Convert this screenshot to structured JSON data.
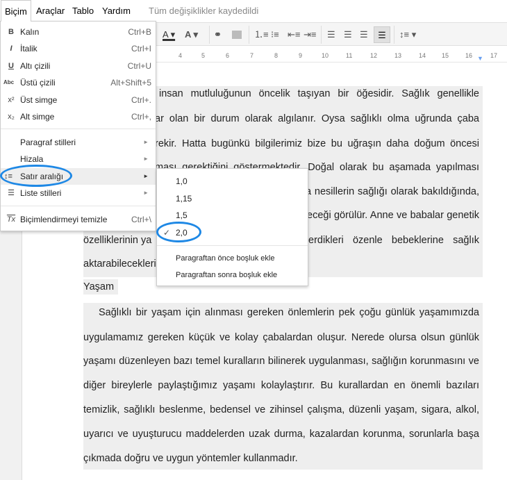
{
  "menubar": {
    "items": [
      "Biçim",
      "Araçlar",
      "Tablo",
      "Yardım"
    ],
    "status": "Tüm değişiklikler kaydedildi"
  },
  "toolbar": {
    "icons": [
      "text-color-icon",
      "highlight-color-icon",
      "link-icon",
      "image-icon",
      "numbered-list-icon",
      "bulleted-list-icon",
      "decrease-indent-icon",
      "increase-indent-icon",
      "align-left-icon",
      "align-center-icon",
      "align-right-icon",
      "justify-icon",
      "line-spacing-icon"
    ],
    "active": "justify-icon"
  },
  "ruler": {
    "ticks": [
      "4",
      "5",
      "6",
      "7",
      "8",
      "9",
      "10",
      "11",
      "12",
      "13",
      "14",
      "15",
      "16",
      "17"
    ]
  },
  "format_menu": {
    "items": [
      {
        "icon": "B",
        "label": "Kalın",
        "shortcut": "Ctrl+B"
      },
      {
        "icon": "I",
        "label": "İtalik",
        "shortcut": "Ctrl+I"
      },
      {
        "icon": "U",
        "label": "Altı çizili",
        "shortcut": "Ctrl+U"
      },
      {
        "icon": "Abc",
        "label": "Üstü çizili",
        "shortcut": "Alt+Shift+5"
      },
      {
        "icon": "x²",
        "label": "Üst simge",
        "shortcut": "Ctrl+."
      },
      {
        "icon": "x₂",
        "label": "Alt simge",
        "shortcut": "Ctrl+,"
      },
      {
        "label": "Paragraf stilleri"
      },
      {
        "label": "Hizala"
      },
      {
        "icon": "↕≡",
        "label": "Satır aralığı"
      },
      {
        "icon": "☰",
        "label": "Liste stilleri"
      },
      {
        "icon": "Tx",
        "label": "Biçimlendirmeyi temizle",
        "shortcut": "Ctrl+\\"
      }
    ]
  },
  "spacing_submenu": {
    "options": [
      "1,0",
      "1,15",
      "1,5",
      "2,0"
    ],
    "selected": "2,0",
    "actions": [
      "Paragraftan önce boşluk ekle",
      "Paragraftan sonra boşluk ekle"
    ]
  },
  "document": {
    "p1": [
      "insan mutluluğunun öncelik taşıyan bir öğesidir. Sağlık genellikle",
      "ar olan bir durum olarak algılanır. Oysa sağlıklı olma uğrunda çaba",
      "rekir. Hatta bugünkü bilgilerimiz bize bu uğraşın daha doğum öncesi",
      "ması gerektiğini göstermektedir. Doğal olarak bu aşamada yapılması",
      "a nesillerin sağlığı olarak bakıldığında,",
      "eceği görülür. Anne ve babalar genetik",
      "özelliklerinin ya",
      "erdikleri özenle bebeklerine sağlık",
      "aktarabilecekleri"
    ],
    "heading": "Yaşam",
    "p2": [
      "Sağlıklı bir yaşam için alınması gereken önlemlerin pek çoğu günlük yaşamımızda",
      "uygulamamız gereken küçük ve kolay çabalardan oluşur. Nerede olursa olsun günlük",
      "yaşamı düzenleyen bazı temel kuralların bilinerek uygulanması, sağlığın korunmasını ve",
      "diğer bireylerle paylaştığımız yaşamı kolaylaştırır. Bu kurallardan en önemli bazıları",
      "temizlik, sağlıklı beslenme, bedensel ve zihinsel çalışma, düzenli yaşam, sigara, alkol,",
      "uyarıcı ve uyuşturucu maddelerden uzak durma, kazalardan korunma, sorunlarla başa",
      "çıkmada doğru ve uygun yöntemler kullanmadır."
    ]
  },
  "colors": {
    "accent": "#1e88e5",
    "highlight": "#eeeeee"
  }
}
